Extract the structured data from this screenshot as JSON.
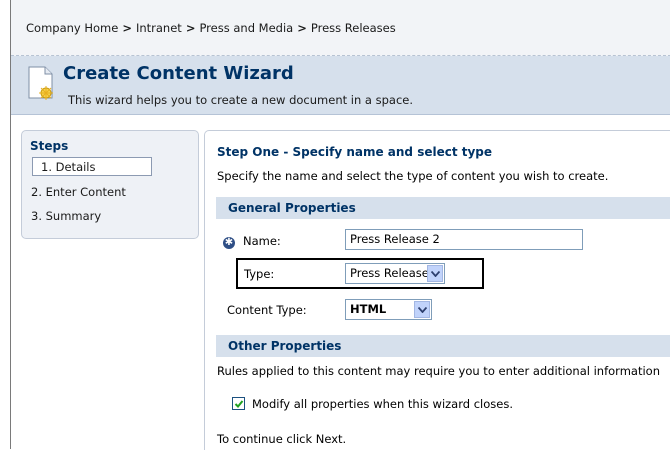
{
  "breadcrumb": {
    "items": [
      "Company Home",
      "Intranet",
      "Press and Media",
      "Press Releases"
    ],
    "separator": ">"
  },
  "header": {
    "title": "Create Content Wizard",
    "description": "This wizard helps you to create a new document in a space."
  },
  "steps": {
    "title": "Steps",
    "items": [
      "1. Details",
      "2. Enter Content",
      "3. Summary"
    ],
    "active_index": 0
  },
  "main": {
    "heading": "Step One - Specify name and select type",
    "description": "Specify the name and select the type of content you wish to create.",
    "general_section": "General Properties",
    "name_label": "Name:",
    "name_value": "Press Release 2",
    "type_label": "Type:",
    "type_value": "Press Release",
    "content_type_label": "Content Type:",
    "content_type_value": "HTML",
    "other_section": "Other Properties",
    "rules_text": "Rules applied to this content may require you to enter additional information",
    "modify_label": "Modify all properties when this wizard closes.",
    "modify_checked": true,
    "continue_text": "To continue click Next."
  },
  "colors": {
    "accent": "#003366",
    "section_bg": "#d6e0ec",
    "panel_bg": "#eef1f6"
  }
}
